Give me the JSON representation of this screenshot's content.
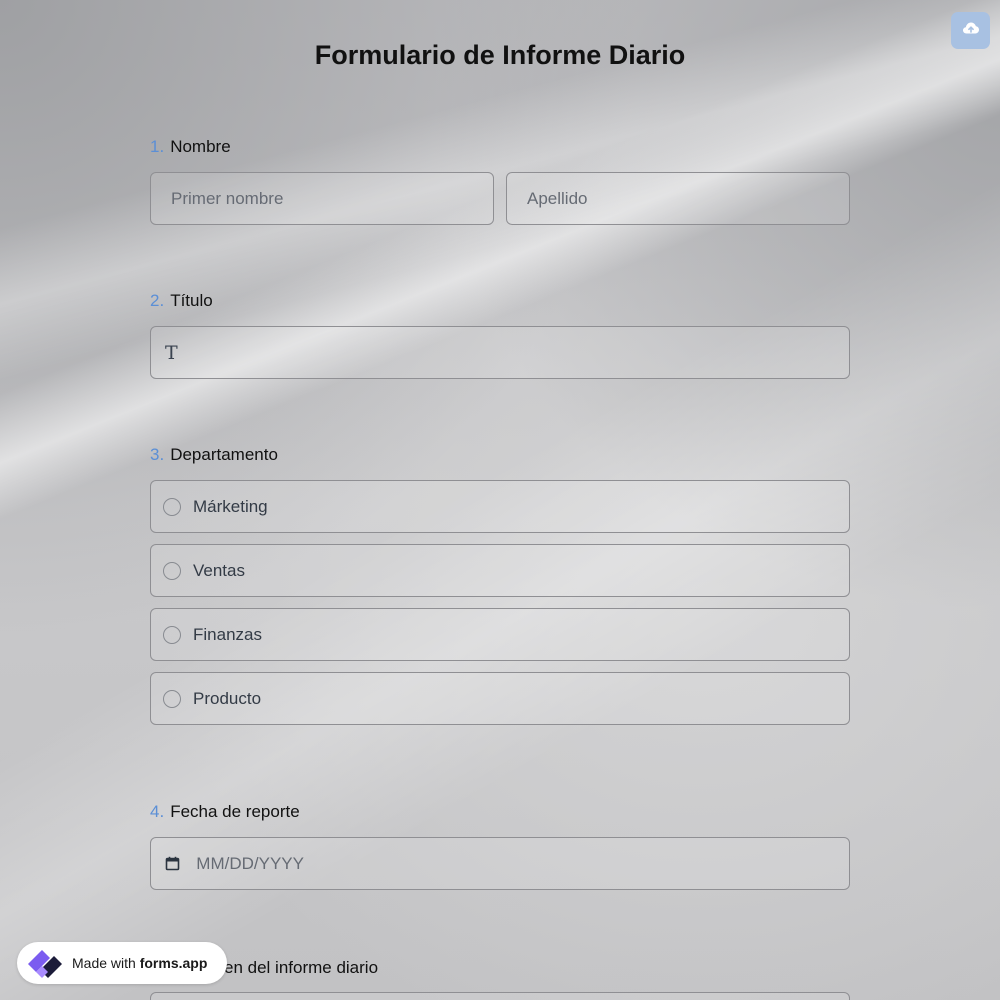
{
  "form": {
    "title": "Formulario de Informe Diario"
  },
  "toolbar": {
    "upload_icon": "cloud-upload-icon"
  },
  "questions": {
    "q1": {
      "number": "1.",
      "label": "Nombre",
      "first_placeholder": "Primer nombre",
      "last_placeholder": "Apellido"
    },
    "q2": {
      "number": "2.",
      "label": "Título",
      "icon": "text-type-icon",
      "icon_glyph": "T"
    },
    "q3": {
      "number": "3.",
      "label": "Departamento",
      "options": [
        "Márketing",
        "Ventas",
        "Finanzas",
        "Producto"
      ]
    },
    "q4": {
      "number": "4.",
      "label": "Fecha de reporte",
      "placeholder": "MM/DD/YYYY",
      "icon": "calendar-icon"
    },
    "q5": {
      "label_visible": "en del informe diario"
    }
  },
  "badge": {
    "prefix": "Made with",
    "brand": "forms.app",
    "logo": "forms-app-logo"
  },
  "colors": {
    "accent": "#5b8fd6",
    "upload_button": "#a8c1e2",
    "logo_purple": "#7b5cf0",
    "logo_dark": "#1c1c3a"
  }
}
